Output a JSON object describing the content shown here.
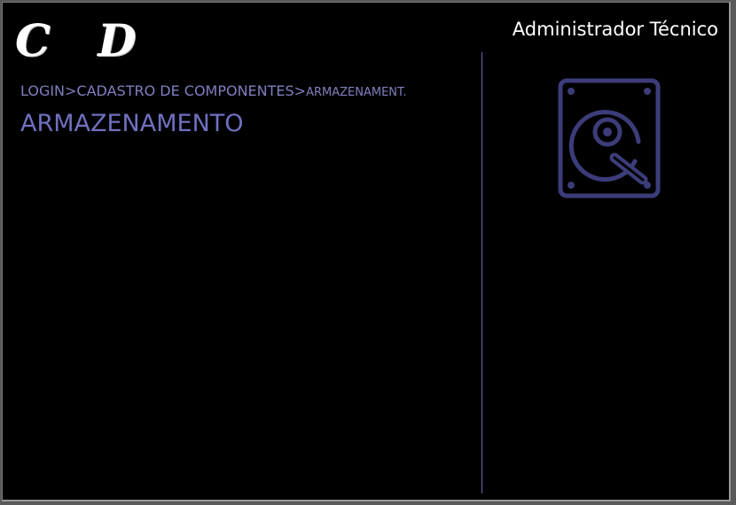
{
  "app": {
    "logo_text": "C D",
    "user_role": "Administrador Técnico"
  },
  "breadcrumb": {
    "path": "LOGIN>CADASTRO DE COMPONENTES>",
    "current": "ARMAZENAMENT."
  },
  "main": {
    "title": "ARMAZENAMENTO",
    "illustration_icon": "hard-drive-icon"
  },
  "colors": {
    "background": "#000000",
    "accent": "#7070c0",
    "icon": "#3c3c7a"
  }
}
